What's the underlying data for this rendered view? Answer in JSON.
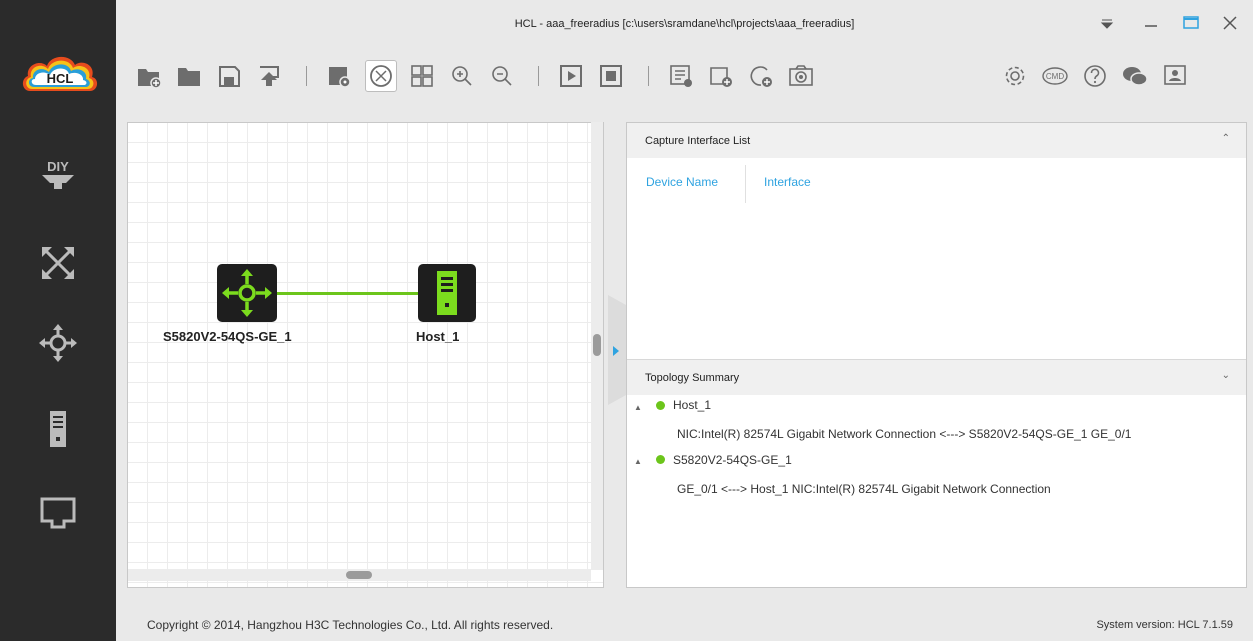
{
  "window": {
    "title": "HCL - aaa_freeradius [c:\\users\\sramdane\\hcl\\projects\\aaa_freeradius]",
    "controls": [
      "dropdown-icon",
      "minimize-icon",
      "maximize-icon",
      "close-icon"
    ]
  },
  "logo": {
    "text": "HCL"
  },
  "sidebar": {
    "items": [
      {
        "name": "diy",
        "icon": "diy-icon",
        "label": "DIY"
      },
      {
        "name": "router",
        "icon": "router-icon"
      },
      {
        "name": "switch",
        "icon": "switch-icon"
      },
      {
        "name": "host",
        "icon": "host-icon"
      },
      {
        "name": "connection",
        "icon": "connection-icon"
      }
    ]
  },
  "toolbar": {
    "buttons": [
      "new-project-icon",
      "open-project-icon",
      "save-icon",
      "export-icon",
      "preview-icon",
      "show-labels-icon",
      "grid-icon",
      "zoom-in-icon",
      "zoom-out-icon",
      "start-icon",
      "stop-icon",
      "list-icon",
      "add-group-icon",
      "add-note-icon",
      "capture-icon",
      "settings-icon",
      "cmd-icon",
      "help-icon",
      "wechat-icon",
      "profile-icon"
    ],
    "cmd_label": "CMD"
  },
  "topology": {
    "devices": [
      {
        "name": "S5820V2-54QS-GE_1",
        "type": "switch"
      },
      {
        "name": "Host_1",
        "type": "host"
      }
    ],
    "links": [
      {
        "from": "S5820V2-54QS-GE_1",
        "to": "Host_1",
        "color": "#6cc51b"
      }
    ]
  },
  "capture_panel": {
    "title": "Capture Interface List",
    "columns": [
      "Device Name",
      "Interface"
    ]
  },
  "summary_panel": {
    "title": "Topology Summary",
    "nodes": [
      {
        "name": "Host_1",
        "detail": "NIC:Intel(R) 82574L Gigabit Network Connection <---> S5820V2-54QS-GE_1 GE_0/1"
      },
      {
        "name": "S5820V2-54QS-GE_1",
        "detail": "GE_0/1 <---> Host_1 NIC:Intel(R) 82574L Gigabit Network Connection"
      }
    ]
  },
  "footer": {
    "copyright": "Copyright © 2014, Hangzhou H3C Technologies Co., Ltd. All rights reserved.",
    "version": "System version: HCL 7.1.59"
  },
  "colors": {
    "accent_green": "#6cc51b",
    "link_blue": "#2fa3e0",
    "sidebar": "#2b2b2b"
  }
}
